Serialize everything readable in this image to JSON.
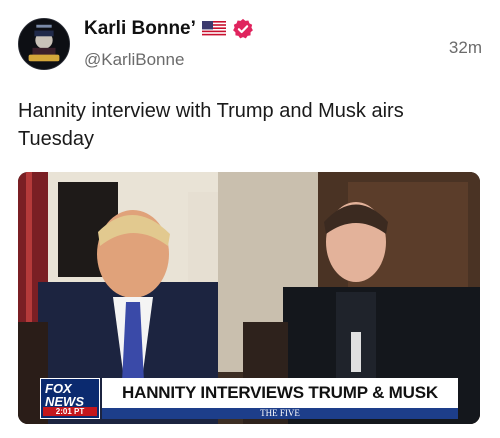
{
  "post": {
    "author": {
      "display_name": "Karli Bonne’",
      "handle": "@KarliBonne",
      "avatar_icon": "avatar-icon",
      "flag_icon": "us-flag-icon",
      "verified_icon": "verified-badge-icon",
      "verified_color": "#e0245e"
    },
    "timestamp": "32m",
    "text": "Hannity interview with Trump and Musk airs Tuesday",
    "media": {
      "chyron_headline": "HANNITY INTERVIEWS TRUMP & MUSK",
      "chyron_sub": "THE FIVE",
      "network_logo_line1": "FOX",
      "network_logo_line2": "NEWS",
      "network_time": "2:01 PT"
    }
  }
}
